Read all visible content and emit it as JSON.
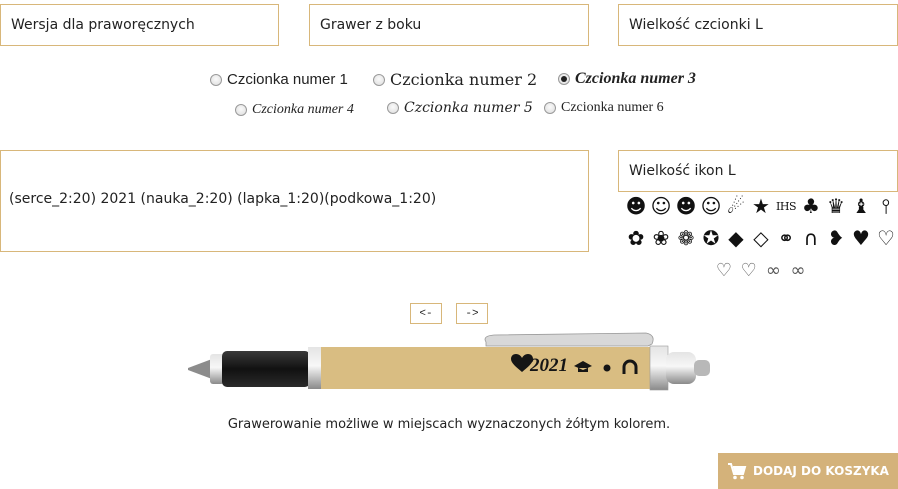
{
  "selects": {
    "handedness": "Wersja dla praworęcznych",
    "engrave_side": "Grawer z boku",
    "font_size": "Wielkość czcionki L",
    "icon_size": "Wielkość ikon L"
  },
  "fonts": {
    "selected": 3,
    "options": [
      "Czcionka numer 1",
      "Czcionka numer 2",
      "Czcionka numer 3",
      "Czcionka numer 4",
      "Czcionka numer 5",
      "Czcionka numer 6"
    ]
  },
  "engrave_input_value": "(serce_2:20) 2021 (nauka_2:20) (lapka_1:20)(podkowa_1:20)",
  "icons": {
    "row1": [
      "smiley-solid",
      "smiley-outline",
      "big-grin-solid",
      "big-grin-outline",
      "shooting-star",
      "star",
      "ihs-cross",
      "four-leaf-clover",
      "crown",
      "cat",
      "tie"
    ],
    "row2": [
      "rose",
      "rose-bud",
      "paw",
      "medal",
      "graduation-cap",
      "graduation-cap-outline",
      "wedding-rings",
      "horseshoe",
      "heart-half",
      "heart-solid",
      "heart-outline"
    ],
    "row3": [
      "double-heart-outline",
      "double-heart-small",
      "infinity-double",
      "infinity"
    ],
    "ihs_label": "IHS"
  },
  "nav": {
    "prev": "<-",
    "next": "->"
  },
  "pen_preview": {
    "text": "2021",
    "colors": {
      "barrel": "#d9bd82",
      "grip": "#222222",
      "metal": "#a8a8a8"
    }
  },
  "info_text": "Grawerowanie możliwe w miejscach wyznaczonych żółtym kolorem.",
  "cart_button": "DODAJ DO KOSZYKA",
  "colors": {
    "accent": "#d4b27a",
    "border": "#d8b77a"
  }
}
